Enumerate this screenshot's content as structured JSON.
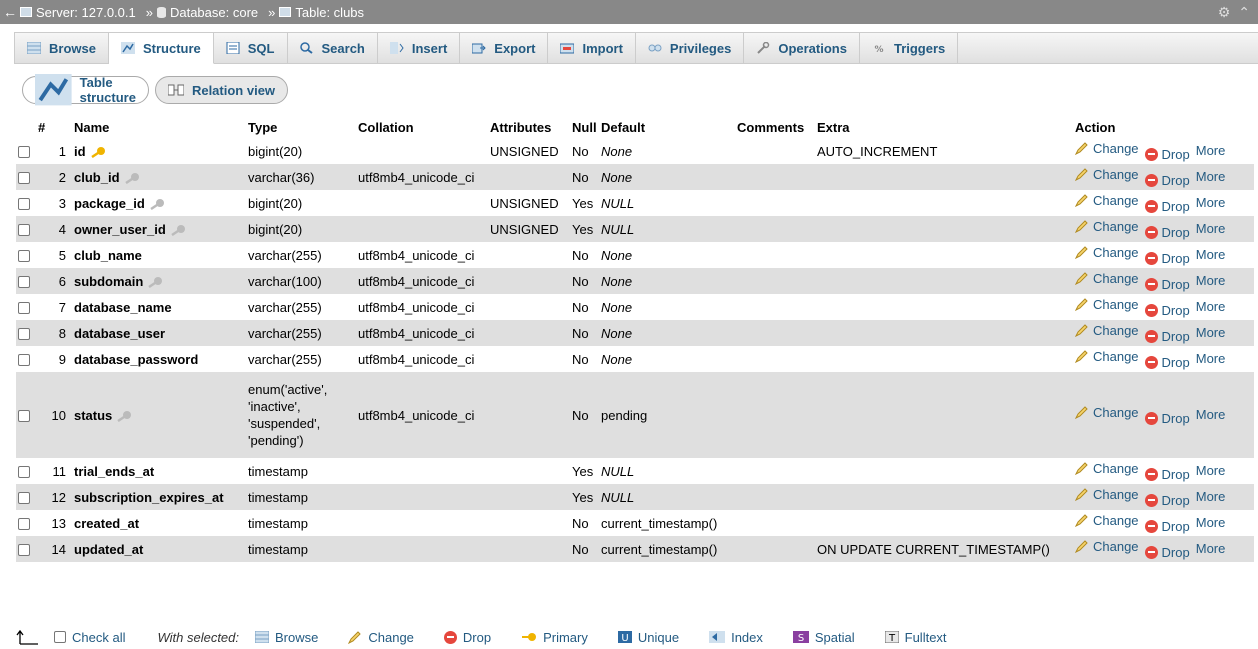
{
  "titlebar": {
    "back": "←",
    "server": "Server: 127.0.0.1",
    "sep1": "»",
    "database": "Database: core",
    "sep2": "»",
    "table": "Table: clubs"
  },
  "tabs": [
    {
      "label": "Browse",
      "icon": "browse-icon"
    },
    {
      "label": "Structure",
      "icon": "structure-icon",
      "active": true
    },
    {
      "label": "SQL",
      "icon": "sql-icon"
    },
    {
      "label": "Search",
      "icon": "search-icon"
    },
    {
      "label": "Insert",
      "icon": "insert-icon"
    },
    {
      "label": "Export",
      "icon": "export-icon"
    },
    {
      "label": "Import",
      "icon": "import-icon"
    },
    {
      "label": "Privileges",
      "icon": "privileges-icon"
    },
    {
      "label": "Operations",
      "icon": "operations-icon"
    },
    {
      "label": "Triggers",
      "icon": "triggers-icon"
    }
  ],
  "subbuttons": {
    "table_structure": "Table structure",
    "relation_view": "Relation view"
  },
  "headers": {
    "num": "#",
    "name": "Name",
    "type": "Type",
    "collation": "Collation",
    "attributes": "Attributes",
    "null": "Null",
    "default": "Default",
    "comments": "Comments",
    "extra": "Extra",
    "action": "Action"
  },
  "actions": {
    "change": "Change",
    "drop": "Drop",
    "more": "More"
  },
  "rows": [
    {
      "num": "1",
      "name": "id",
      "key": "primary",
      "type": "bigint(20)",
      "collation": "",
      "attributes": "UNSIGNED",
      "null": "No",
      "default": "None",
      "default_italic": true,
      "extra": "AUTO_INCREMENT"
    },
    {
      "num": "2",
      "name": "club_id",
      "key": "index",
      "type": "varchar(36)",
      "collation": "utf8mb4_unicode_ci",
      "attributes": "",
      "null": "No",
      "default": "None",
      "default_italic": true,
      "extra": ""
    },
    {
      "num": "3",
      "name": "package_id",
      "key": "index",
      "type": "bigint(20)",
      "collation": "",
      "attributes": "UNSIGNED",
      "null": "Yes",
      "default": "NULL",
      "default_italic": true,
      "extra": ""
    },
    {
      "num": "4",
      "name": "owner_user_id",
      "key": "index",
      "type": "bigint(20)",
      "collation": "",
      "attributes": "UNSIGNED",
      "null": "Yes",
      "default": "NULL",
      "default_italic": true,
      "extra": ""
    },
    {
      "num": "5",
      "name": "club_name",
      "key": "",
      "type": "varchar(255)",
      "collation": "utf8mb4_unicode_ci",
      "attributes": "",
      "null": "No",
      "default": "None",
      "default_italic": true,
      "extra": ""
    },
    {
      "num": "6",
      "name": "subdomain",
      "key": "index",
      "type": "varchar(100)",
      "collation": "utf8mb4_unicode_ci",
      "attributes": "",
      "null": "No",
      "default": "None",
      "default_italic": true,
      "extra": ""
    },
    {
      "num": "7",
      "name": "database_name",
      "key": "",
      "type": "varchar(255)",
      "collation": "utf8mb4_unicode_ci",
      "attributes": "",
      "null": "No",
      "default": "None",
      "default_italic": true,
      "extra": ""
    },
    {
      "num": "8",
      "name": "database_user",
      "key": "",
      "type": "varchar(255)",
      "collation": "utf8mb4_unicode_ci",
      "attributes": "",
      "null": "No",
      "default": "None",
      "default_italic": true,
      "extra": ""
    },
    {
      "num": "9",
      "name": "database_password",
      "key": "",
      "type": "varchar(255)",
      "collation": "utf8mb4_unicode_ci",
      "attributes": "",
      "null": "No",
      "default": "None",
      "default_italic": true,
      "extra": ""
    },
    {
      "num": "10",
      "name": "status",
      "key": "index",
      "type": "enum('active', 'inactive', 'suspended', 'pending')",
      "collation": "utf8mb4_unicode_ci",
      "attributes": "",
      "null": "No",
      "default": "pending",
      "default_italic": false,
      "extra": "",
      "tall": true
    },
    {
      "num": "11",
      "name": "trial_ends_at",
      "key": "",
      "type": "timestamp",
      "collation": "",
      "attributes": "",
      "null": "Yes",
      "default": "NULL",
      "default_italic": true,
      "extra": ""
    },
    {
      "num": "12",
      "name": "subscription_expires_at",
      "key": "",
      "type": "timestamp",
      "collation": "",
      "attributes": "",
      "null": "Yes",
      "default": "NULL",
      "default_italic": true,
      "extra": ""
    },
    {
      "num": "13",
      "name": "created_at",
      "key": "",
      "type": "timestamp",
      "collation": "",
      "attributes": "",
      "null": "No",
      "default": "current_timestamp()",
      "default_italic": false,
      "extra": ""
    },
    {
      "num": "14",
      "name": "updated_at",
      "key": "",
      "type": "timestamp",
      "collation": "",
      "attributes": "",
      "null": "No",
      "default": "current_timestamp()",
      "default_italic": false,
      "extra": "ON UPDATE CURRENT_TIMESTAMP()"
    }
  ],
  "footer": {
    "check_all": "Check all",
    "with_selected": "With selected:",
    "browse": "Browse",
    "change": "Change",
    "drop": "Drop",
    "primary": "Primary",
    "unique": "Unique",
    "index": "Index",
    "spatial": "Spatial",
    "fulltext": "Fulltext"
  },
  "colors": {
    "link": "#235a81",
    "titlebar": "#888888",
    "row_alt": "#dfdfdf",
    "drop_red": "#e5473d",
    "key_gold": "#f0b400",
    "key_gray": "#bbbbbb"
  }
}
